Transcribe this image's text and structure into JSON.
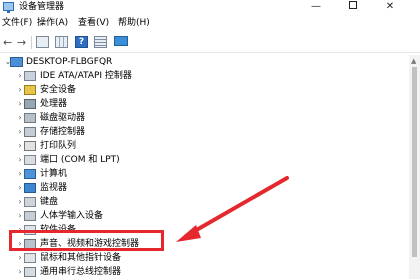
{
  "window": {
    "title": "设备管理器",
    "minimize": "—",
    "close": "✕"
  },
  "menu": [
    "文件(F)",
    "操作(A)",
    "查看(V)",
    "帮助(H)"
  ],
  "toolbar": {
    "back": "←",
    "forward": "→",
    "help": "?"
  },
  "tree": {
    "root": "DESKTOP-FLBGFQR",
    "items": [
      "IDE ATA/ATAPI 控制器",
      "安全设备",
      "处理器",
      "磁盘驱动器",
      "存储控制器",
      "打印队列",
      "端口 (COM 和 LPT)",
      "计算机",
      "监视器",
      "键盘",
      "人体学输入设备",
      "软件设备",
      "声音、视频和游戏控制器",
      "鼠标和其他指针设备",
      "通用串行总线控制器"
    ]
  },
  "annotation": {
    "color": "#e5282e",
    "highlighted_item": "声音、视频和游戏控制器"
  }
}
